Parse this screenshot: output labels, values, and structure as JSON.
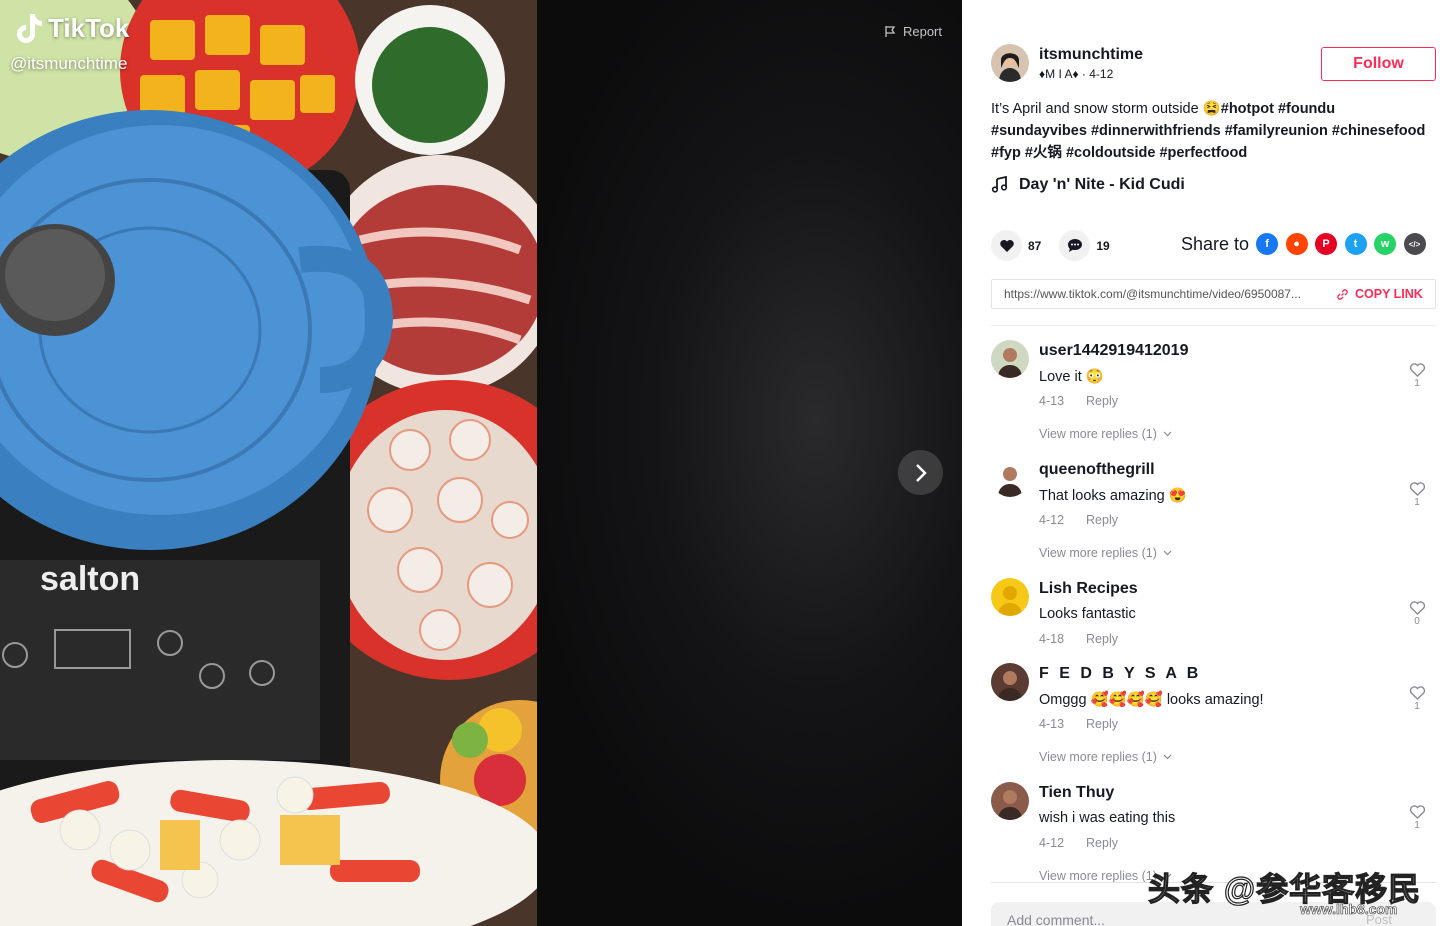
{
  "video": {
    "brand": "TikTok",
    "handle": "@itsmunchtime",
    "report_label": "Report"
  },
  "author": {
    "username": "itsmunchtime",
    "nickname": "♦M I A♦",
    "date": " · 4-12",
    "follow_label": "Follow"
  },
  "caption": {
    "text": "It’s April and snow storm outside 😫",
    "tags": [
      "#hotpot",
      "#foundu",
      "#sundayvibes",
      "#dinnerwithfriends",
      "#familyreunion",
      "#chinesefood",
      "#fyp",
      "#火锅",
      "#coldoutside",
      "#perfectfood"
    ]
  },
  "music": {
    "title": "Day 'n' Nite - Kid Cudi"
  },
  "stats": {
    "likes": "87",
    "comments": "19"
  },
  "share": {
    "label": "Share to",
    "targets": [
      {
        "name": "facebook-icon",
        "color": "#1877f2",
        "glyph": "f"
      },
      {
        "name": "reddit-icon",
        "color": "#ff4500",
        "glyph": "●"
      },
      {
        "name": "pinterest-icon",
        "color": "#e60023",
        "glyph": "P"
      },
      {
        "name": "twitter-icon",
        "color": "#1da1f2",
        "glyph": "t"
      },
      {
        "name": "whatsapp-icon",
        "color": "#25d366",
        "glyph": "w"
      },
      {
        "name": "embed-icon",
        "color": "#4b4b4f",
        "glyph": "</>"
      }
    ]
  },
  "link": {
    "url": "https://www.tiktok.com/@itsmunchtime/video/6950087...",
    "copy_label": "COPY LINK"
  },
  "comments": [
    {
      "user": "user1442919412019",
      "text": "Love it 😳",
      "date": "4-13",
      "reply": "Reply",
      "likes": "1",
      "more": "View more replies (1)"
    },
    {
      "user": "queenofthegrill",
      "text": "That looks amazing 😍",
      "date": "4-12",
      "reply": "Reply",
      "likes": "1",
      "more": "View more replies (1)"
    },
    {
      "user": "Lish Recipes",
      "text": "Looks fantastic",
      "date": "4-18",
      "reply": "Reply",
      "likes": "0",
      "more": ""
    },
    {
      "user": "F E D B Y S A B",
      "text": "Omggg 🥰🥰🥰🥰 looks amazing!",
      "date": "4-13",
      "reply": "Reply",
      "likes": "1",
      "more": "View more replies (1)"
    },
    {
      "user": "Tien Thuy",
      "text": "wish i was eating this",
      "date": "4-12",
      "reply": "Reply",
      "likes": "1",
      "more": "View more replies (1)"
    }
  ],
  "composer": {
    "placeholder": "Add comment...",
    "post_label": "Post"
  },
  "watermark": {
    "text": "头条 @参华客移民",
    "site": "www.lhb8.com"
  }
}
